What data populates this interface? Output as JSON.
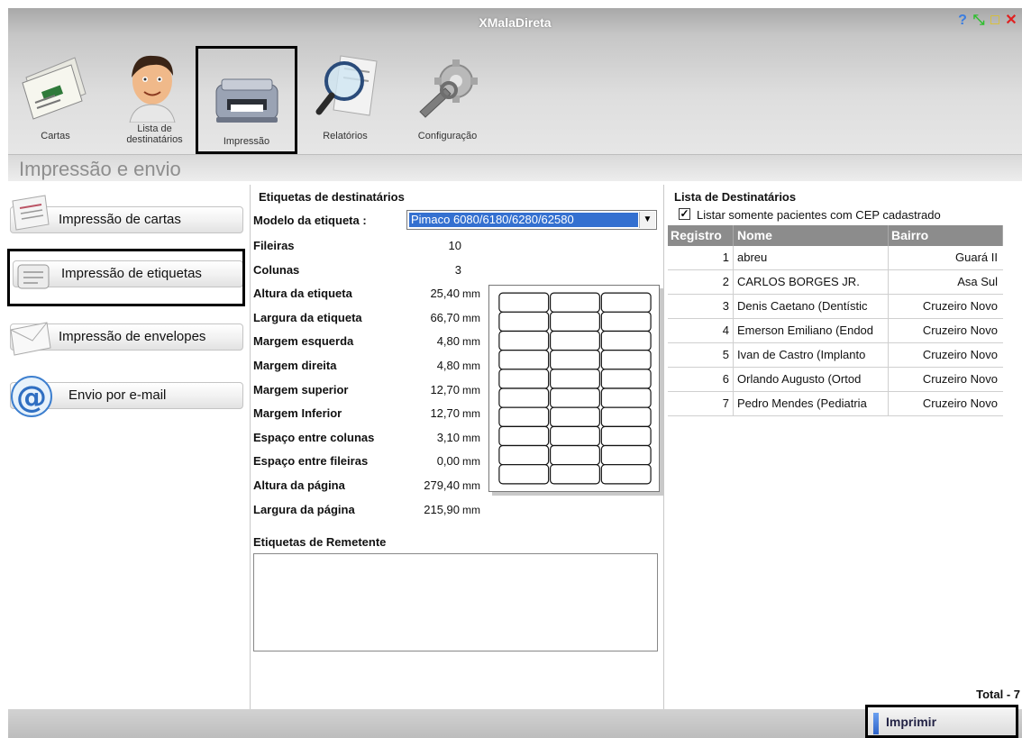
{
  "window": {
    "title": "XMalaDireta",
    "controls": [
      "help-icon",
      "minimize-icon",
      "maximize-icon",
      "close-icon"
    ]
  },
  "toolbar": {
    "items": [
      {
        "label": "Cartas",
        "icon": "letters-icon"
      },
      {
        "label_line1": "Lista de",
        "label_line2": "destinatários",
        "icon": "person-icon"
      },
      {
        "label": "Impressão",
        "icon": "printer-icon",
        "selected": true
      },
      {
        "label": "Relatórios",
        "icon": "magnifier-report-icon"
      },
      {
        "label": "Configuração",
        "icon": "wrench-gear-icon"
      }
    ]
  },
  "section": {
    "title": "Impressão e envio"
  },
  "nav": {
    "items": [
      {
        "label": "Impressão de cartas",
        "icon": "letter-icon"
      },
      {
        "label": "Impressão de etiquetas",
        "icon": "label-icon",
        "selected": true
      },
      {
        "label": "Impressão de envelopes",
        "icon": "envelope-icon"
      },
      {
        "label": "Envio por e-mail",
        "icon": "at-sign-icon"
      }
    ]
  },
  "labels": {
    "heading": "Etiquetas de destinatários",
    "model_label": "Modelo da etiqueta :",
    "model_value": "Pimaco 6080/6180/6280/62580",
    "unit": "mm",
    "fields": [
      {
        "label": "Fileiras",
        "value": "10"
      },
      {
        "label": "Colunas",
        "value": "3"
      },
      {
        "label": "Altura da etiqueta",
        "value": "25,40"
      },
      {
        "label": "Largura da etiqueta",
        "value": "66,70"
      },
      {
        "label": "Margem esquerda",
        "value": "4,80"
      },
      {
        "label": "Margem direita",
        "value": "4,80"
      },
      {
        "label": "Margem superior",
        "value": "12,70"
      },
      {
        "label": "Margem Inferior",
        "value": "12,70"
      },
      {
        "label": "Espaço entre colunas",
        "value": "3,10"
      },
      {
        "label": "Espaço entre fileiras",
        "value": "0,00"
      },
      {
        "label": "Altura da página",
        "value": "279,40"
      },
      {
        "label": "Largura da página",
        "value": "215,90"
      }
    ],
    "preview": {
      "rows": 10,
      "columns": 3
    },
    "sender_heading": "Etiquetas de Remetente",
    "sender_text": ""
  },
  "recipients": {
    "heading": "Lista de Destinatários",
    "filter_label": "Listar somente pacientes com CEP cadastrado",
    "filter_checked": true,
    "columns": [
      "Registro",
      "Nome",
      "Bairro"
    ],
    "rows": [
      {
        "registro": "1",
        "nome": "abreu",
        "bairro": "Guará II"
      },
      {
        "registro": "2",
        "nome": "CARLOS BORGES JR.",
        "bairro": "Asa Sul"
      },
      {
        "registro": "3",
        "nome": "Denis Caetano (Dentístic",
        "bairro": "Cruzeiro Novo"
      },
      {
        "registro": "4",
        "nome": "Emerson Emiliano (Endod",
        "bairro": "Cruzeiro Novo"
      },
      {
        "registro": "5",
        "nome": "Ivan de Castro (Implanto",
        "bairro": "Cruzeiro Novo"
      },
      {
        "registro": "6",
        "nome": "Orlando Augusto (Ortod",
        "bairro": "Cruzeiro Novo"
      },
      {
        "registro": "7",
        "nome": "Pedro Mendes (Pediatria",
        "bairro": "Cruzeiro Novo"
      }
    ],
    "total": "Total - 7"
  },
  "actions": {
    "print_label": "Imprimir"
  },
  "colors": {
    "accent": "#3470d0",
    "table_header": "#8c8c8c",
    "title_text": "#ffffff"
  }
}
